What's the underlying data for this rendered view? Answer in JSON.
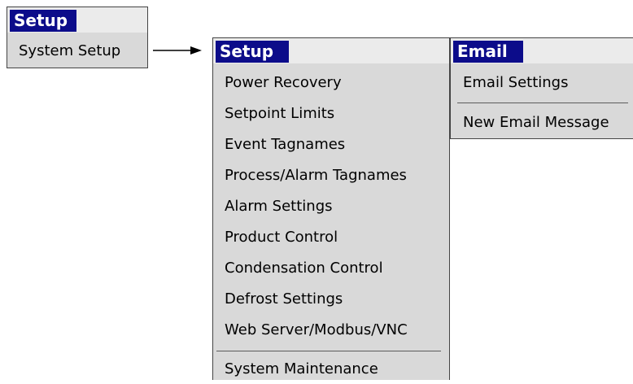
{
  "root_menu": {
    "title": "Setup",
    "items": [
      {
        "label": "System Setup"
      }
    ]
  },
  "setup_menu": {
    "title": "Setup",
    "items": [
      {
        "label": "Power Recovery"
      },
      {
        "label": "Setpoint Limits"
      },
      {
        "label": "Event Tagnames"
      },
      {
        "label": "Process/Alarm Tagnames"
      },
      {
        "label": "Alarm Settings"
      },
      {
        "label": "Product Control"
      },
      {
        "label": "Condensation Control"
      },
      {
        "label": "Defrost Settings"
      },
      {
        "label": "Web Server/Modbus/VNC"
      },
      {
        "label": "System Maintenance"
      }
    ]
  },
  "email_menu": {
    "title": "Email",
    "items": [
      {
        "label": "Email Settings"
      },
      {
        "label": "New Email Message"
      }
    ]
  },
  "colors": {
    "title_bar": "#0c0c8a",
    "menu_background": "#d9d9d9",
    "title_strip": "#ebebeb"
  },
  "icons": {
    "connector": "arrow-right-icon"
  }
}
